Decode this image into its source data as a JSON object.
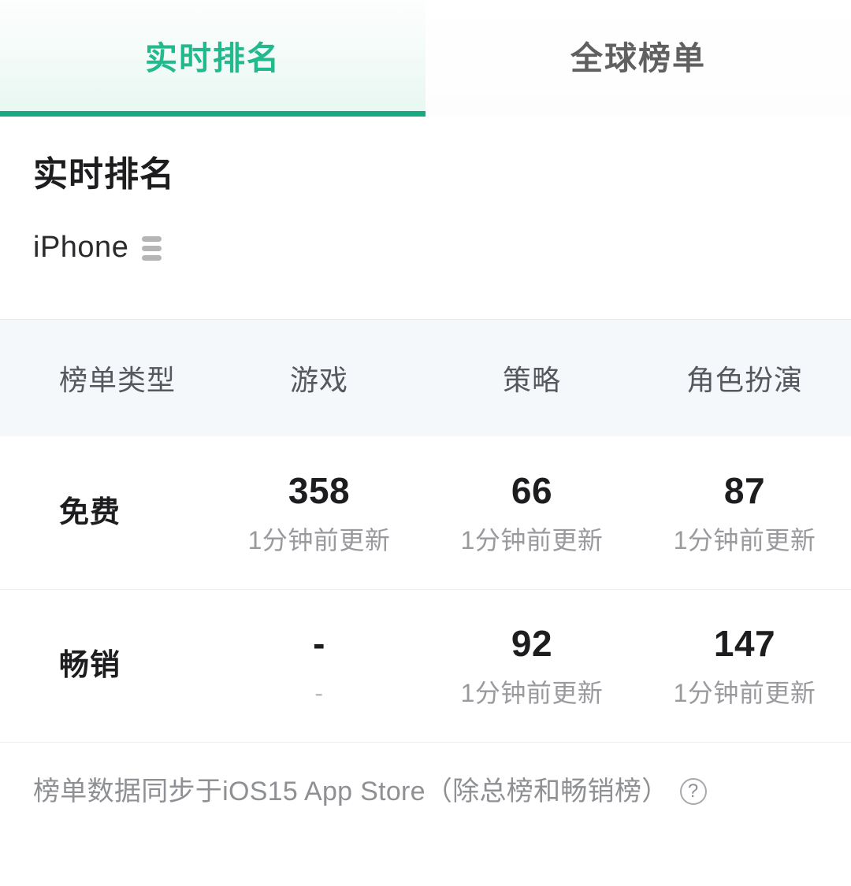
{
  "tabs": [
    {
      "label": "实时排名",
      "active": true
    },
    {
      "label": "全球榜单",
      "active": false
    }
  ],
  "header": {
    "title": "实时排名",
    "device": "iPhone",
    "device_icon": "list-icon"
  },
  "table": {
    "columns": [
      "榜单类型",
      "游戏",
      "策略",
      "角色扮演"
    ],
    "rows": [
      {
        "label": "免费",
        "cells": [
          {
            "value": "358",
            "sub": "1分钟前更新"
          },
          {
            "value": "66",
            "sub": "1分钟前更新"
          },
          {
            "value": "87",
            "sub": "1分钟前更新"
          }
        ]
      },
      {
        "label": "畅销",
        "cells": [
          {
            "value": "-",
            "sub": "-"
          },
          {
            "value": "92",
            "sub": "1分钟前更新"
          },
          {
            "value": "147",
            "sub": "1分钟前更新"
          }
        ]
      }
    ]
  },
  "footer": {
    "note": "榜单数据同步于iOS15 App Store（除总榜和畅销榜）",
    "help_icon": "question-circle-icon"
  },
  "colors": {
    "accent_green": "#16a982",
    "tab_active_text": "#22b98c",
    "table_header_bg": "#f4f8fb",
    "muted_text": "#9a9a9e"
  }
}
